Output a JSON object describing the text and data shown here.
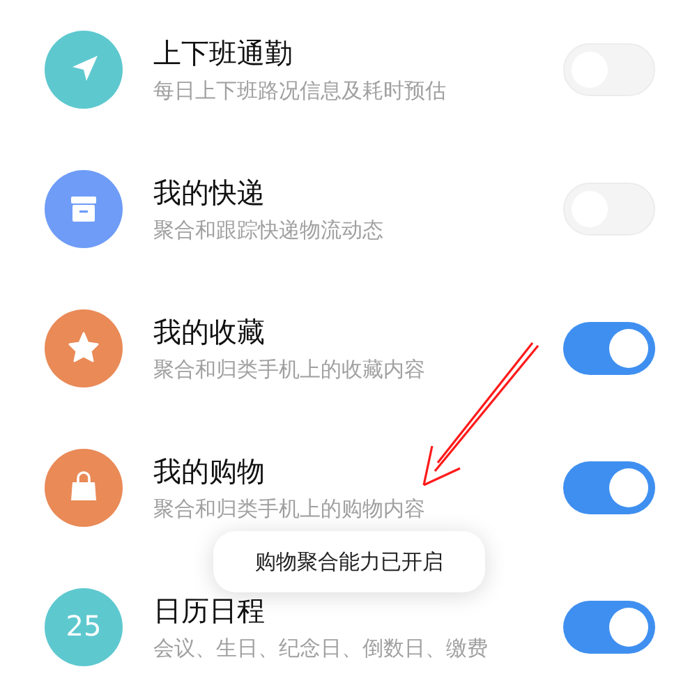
{
  "items": [
    {
      "kind": "navigation",
      "color": "#5ec8cf",
      "title": "上下班通勤",
      "subtitle": "每日上下班路况信息及耗时预估",
      "on": false
    },
    {
      "kind": "box",
      "color": "#6e9cf7",
      "title": "我的快递",
      "subtitle": "聚合和跟踪快递物流动态",
      "on": false
    },
    {
      "kind": "star",
      "color": "#e98a57",
      "title": "我的收藏",
      "subtitle": "聚合和归类手机上的收藏内容",
      "on": true
    },
    {
      "kind": "bag",
      "color": "#e98a57",
      "title": "我的购物",
      "subtitle": "聚合和归类手机上的购物内容",
      "on": true
    },
    {
      "kind": "date",
      "color": "#5ec8cf",
      "icon_text": "25",
      "title": "日历日程",
      "subtitle": "会议、生日、纪念日、倒数日、缴费",
      "on": true
    }
  ],
  "toast": "购物聚合能力已开启"
}
